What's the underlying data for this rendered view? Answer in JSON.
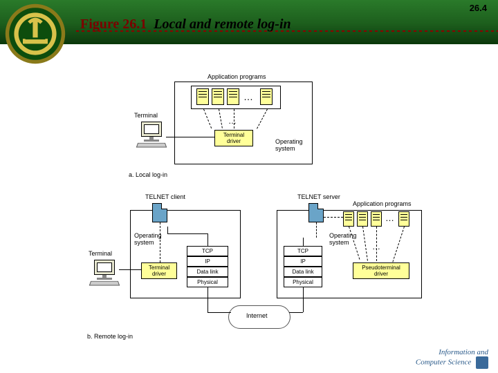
{
  "page_number": "26.4",
  "figure": {
    "number": "Figure 26.1",
    "caption": "Local and remote log-in"
  },
  "diagram_a": {
    "caption": "a. Local log-in",
    "terminal_label": "Terminal",
    "application_programs": "Application programs",
    "terminal_driver": "Terminal driver",
    "operating_system": "Operating system",
    "ellipsis": "…"
  },
  "diagram_b": {
    "caption": "b. Remote log-in",
    "terminal_label": "Terminal",
    "telnet_client": "TELNET client",
    "telnet_server": "TELNET server",
    "application_programs": "Application programs",
    "operating_system_left": "Operating system",
    "operating_system_right": "Operating system",
    "terminal_driver": "Terminal driver",
    "pseudoterminal_driver": "Pseudoterminal driver",
    "internet": "Internet",
    "stack": {
      "tcp": "TCP",
      "ip": "IP",
      "datalink": "Data link",
      "physical": "Physical"
    },
    "ellipsis": "…"
  },
  "footer": {
    "line1": "Information and",
    "line2": "Computer Science"
  }
}
